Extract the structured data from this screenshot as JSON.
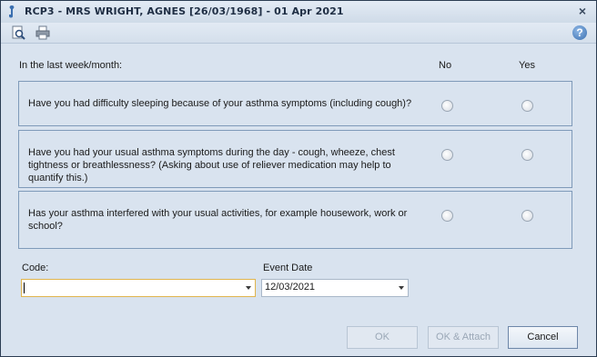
{
  "window": {
    "title": "RCP3 - MRS WRIGHT, AGNES [26/03/1968] - 01 Apr 2021",
    "close_label": "×"
  },
  "toolbar": {
    "icons": [
      "preview-icon",
      "print-icon"
    ],
    "help_label": "?"
  },
  "form": {
    "intro": "In the last week/month:",
    "col_no": "No",
    "col_yes": "Yes",
    "questions": [
      {
        "text": "Have you had difficulty sleeping because of your asthma symptoms (including cough)?",
        "no_selected": false,
        "yes_selected": false
      },
      {
        "text": "Have you had your usual asthma symptoms during the day - cough, wheeze, chest tightness or breathlessness? (Asking about use of reliever medication may help to quantify this.)",
        "no_selected": false,
        "yes_selected": false
      },
      {
        "text": "Has your asthma interfered with your usual activities, for example housework, work or school?",
        "no_selected": false,
        "yes_selected": false
      }
    ],
    "code_label": "Code:",
    "code_value": "",
    "event_date_label": "Event Date",
    "event_date_value": "12/03/2021"
  },
  "buttons": {
    "ok": "OK",
    "ok_attach": "OK & Attach",
    "cancel": "Cancel"
  },
  "colors": {
    "background": "#d9e3ef",
    "border": "#7f9ab9",
    "focus": "#e0b54e"
  }
}
